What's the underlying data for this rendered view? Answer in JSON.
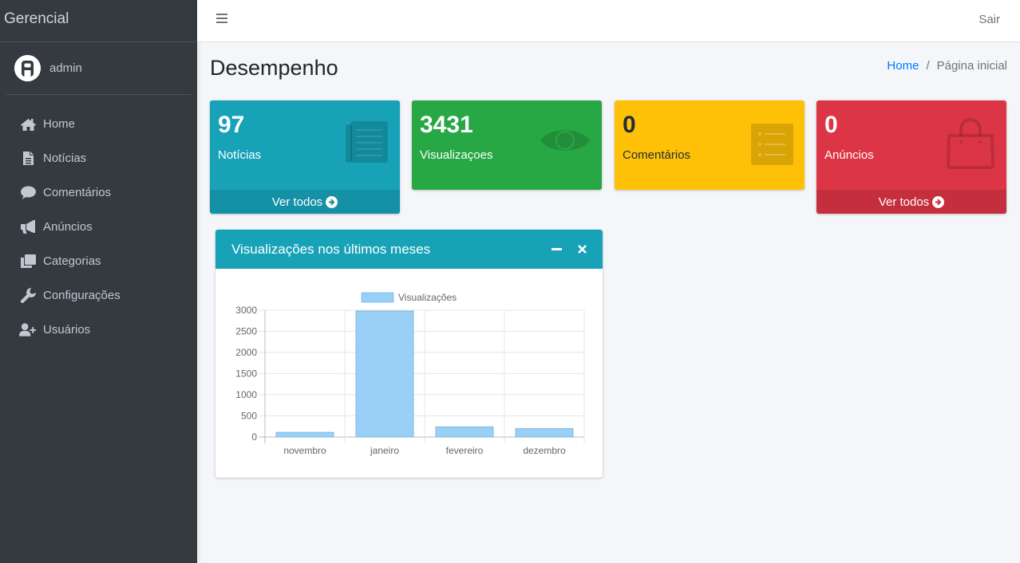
{
  "sidebar": {
    "brand": "Gerencial",
    "user": "admin",
    "items": [
      {
        "label": "Home",
        "icon": "home-icon"
      },
      {
        "label": "Notícias",
        "icon": "file-icon"
      },
      {
        "label": "Comentários",
        "icon": "comment-icon"
      },
      {
        "label": "Anúncios",
        "icon": "bullhorn-icon"
      },
      {
        "label": "Categorias",
        "icon": "clone-icon"
      },
      {
        "label": "Configurações",
        "icon": "wrench-icon"
      },
      {
        "label": "Usuários",
        "icon": "user-plus-icon"
      }
    ]
  },
  "header": {
    "logout": "Sair"
  },
  "content": {
    "title": "Desempenho",
    "breadcrumb": {
      "home": "Home",
      "separator": "/",
      "current": "Página inicial"
    }
  },
  "boxes": [
    {
      "value": "97",
      "label": "Notícias",
      "footer": "Ver todos",
      "color": "#17a2b8",
      "icon": "newspaper-icon"
    },
    {
      "value": "3431",
      "label": "Visualizaçoes",
      "color": "#28a745",
      "icon": "eye-icon"
    },
    {
      "value": "0",
      "label": "Comentários",
      "color": "#ffc107",
      "icon": "list-icon"
    },
    {
      "value": "0",
      "label": "Anúncios",
      "footer": "Ver todos",
      "color": "#dc3545",
      "icon": "shopping-bag-icon"
    }
  ],
  "card": {
    "title": "Visualizações nos últimos meses"
  },
  "chart_data": {
    "type": "bar",
    "categories": [
      "novembro",
      "janeiro",
      "fevereiro",
      "dezembro"
    ],
    "series": [
      {
        "name": "Visualizações",
        "values": [
          110,
          2980,
          240,
          200
        ],
        "color": "#9ad0f5"
      }
    ],
    "yticks": [
      "0",
      "500",
      "1000",
      "1500",
      "2000",
      "2500",
      "3000"
    ],
    "ylim": [
      0,
      3000
    ],
    "legend": "top",
    "grid": true
  }
}
